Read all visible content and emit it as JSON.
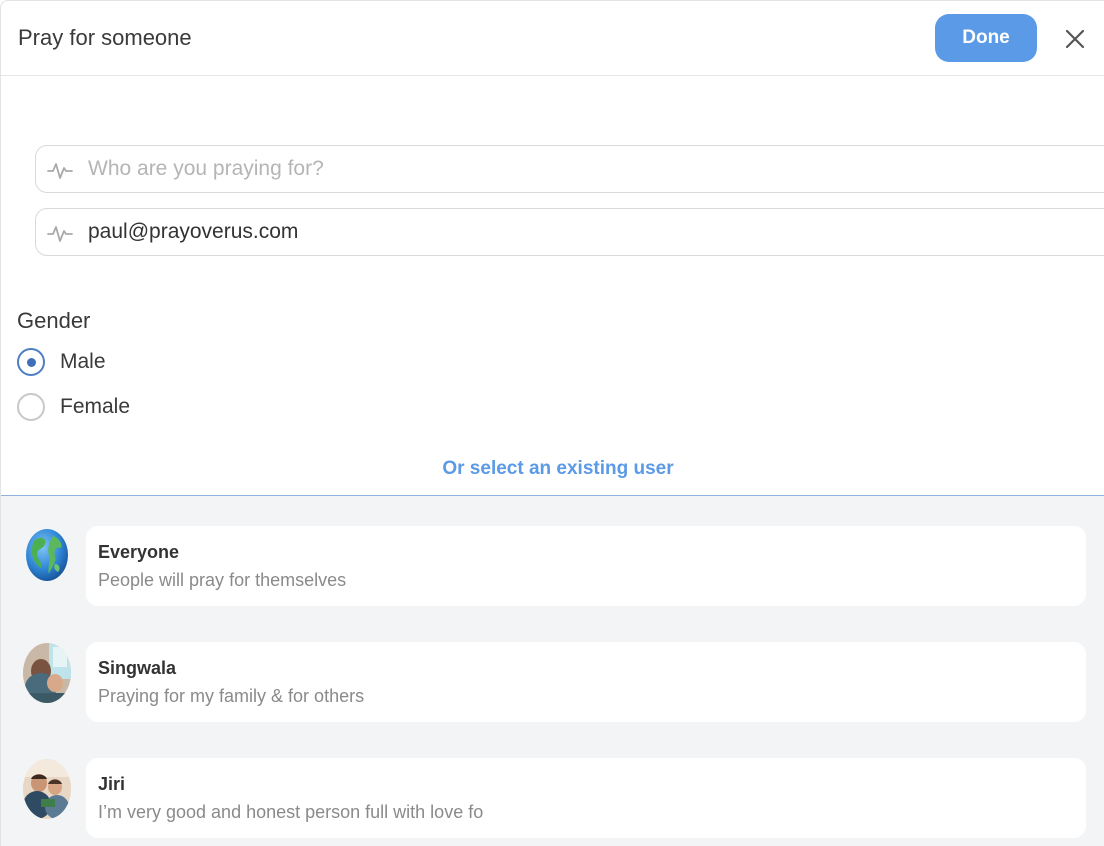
{
  "header": {
    "title": "Pray for someone",
    "done_label": "Done"
  },
  "form": {
    "name_placeholder": "Who are you praying for?",
    "name_value": "",
    "email_value": "paul@prayoverus.com"
  },
  "gender": {
    "label": "Gender",
    "options": [
      {
        "label": "Male",
        "checked": true
      },
      {
        "label": "Female",
        "checked": false
      }
    ]
  },
  "select_existing_label": "Or select an existing user",
  "users": [
    {
      "name": "Everyone",
      "description": "People will pray for themselves",
      "avatar": "globe-icon"
    },
    {
      "name": "Singwala",
      "description": "Praying for my family & for others",
      "avatar": "photo"
    },
    {
      "name": "Jiri",
      "description": "I’m very good and honest person full with love fo",
      "avatar": "photo"
    }
  ],
  "colors": {
    "accent": "#5b9ae6",
    "radio_checked": "#3f6fb8",
    "list_bg": "#f3f4f6"
  }
}
